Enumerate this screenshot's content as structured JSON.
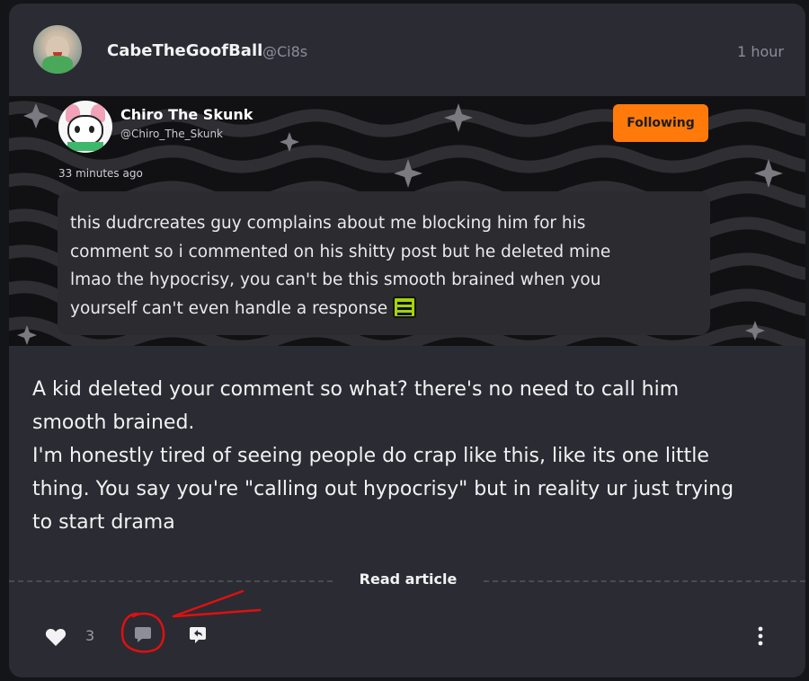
{
  "post": {
    "username": "CabeTheGoofBall",
    "handle": "@Ci8s",
    "time": "1 hour",
    "body_lines": [
      "A kid deleted your comment so what? there's no need to call him",
      "smooth brained.",
      "I'm honestly tired of seeing people do crap like this, like its one little",
      "thing. You say you're \"calling out hypocrisy\" but in reality ur just trying",
      "to start drama"
    ],
    "read_article_label": "Read article",
    "like_count": "3"
  },
  "embed": {
    "name": "Chiro The Skunk",
    "handle": "@Chiro_The_Skunk",
    "follow_label": "Following",
    "time": "33 minutes ago",
    "text_lines": [
      "this dudrcreates guy complains about me blocking him for his",
      "comment so i commented on his shitty post but he deleted mine",
      "lmao the hypocrisy, you can't be this smooth brained when you",
      "yourself can't even handle a response"
    ]
  },
  "icons": {
    "like": "heart-icon",
    "comment": "comment-icon",
    "share": "share-icon",
    "more": "more-vertical-icon"
  },
  "colors": {
    "card_bg": "#2b2b33",
    "page_bg": "#141519",
    "accent_orange": "#ff7a0a",
    "annotation_red": "#e01010"
  }
}
